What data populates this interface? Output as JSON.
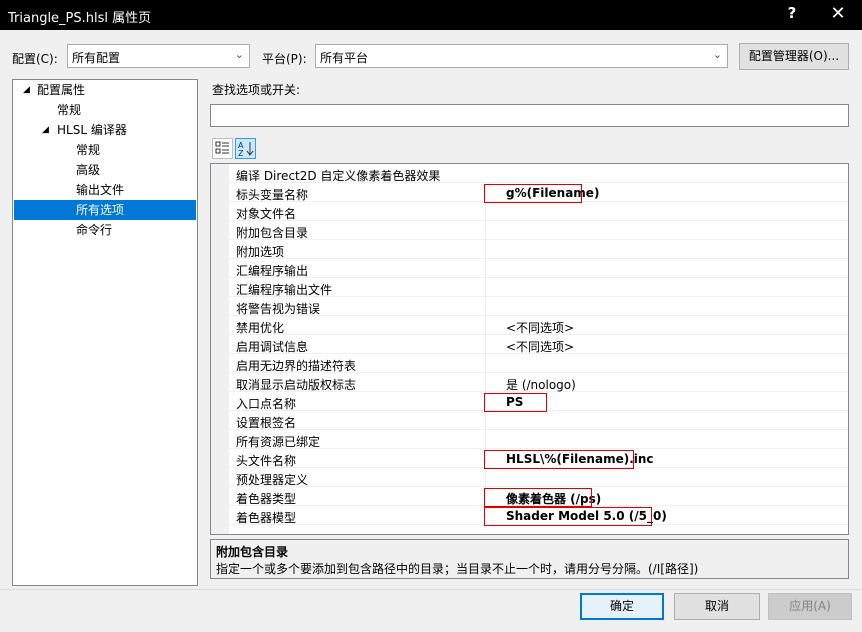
{
  "window": {
    "title": "Triangle_PS.hlsl 属性页",
    "help": "?",
    "close": "✕"
  },
  "config": {
    "label": "配置(C):",
    "value": "所有配置"
  },
  "platform": {
    "label": "平台(P):",
    "value": "所有平台"
  },
  "config_manager_label": "配置管理器(O)...",
  "tree": {
    "root": "配置属性",
    "general": "常规",
    "hlsl": "HLSL 编译器",
    "hlsl_general": "常规",
    "advanced": "高级",
    "output_files": "输出文件",
    "all_options": "所有选项",
    "command_line": "命令行"
  },
  "search_label": "查找选项或开关:",
  "search_value": "",
  "toolbar": {
    "categorized": "categorized-icon",
    "alphabetical": "sort-az-icon"
  },
  "grid": {
    "header": "编译 Direct2D 自定义像素着色器效果",
    "rows": [
      {
        "name": "标头变量名称",
        "value": "g%(Filename)"
      },
      {
        "name": "对象文件名",
        "value": ""
      },
      {
        "name": "附加包含目录",
        "value": ""
      },
      {
        "name": "附加选项",
        "value": ""
      },
      {
        "name": "汇编程序输出",
        "value": ""
      },
      {
        "name": "汇编程序输出文件",
        "value": ""
      },
      {
        "name": "将警告视为错误",
        "value": ""
      },
      {
        "name": "禁用优化",
        "value": "<不同选项>"
      },
      {
        "name": "启用调试信息",
        "value": "<不同选项>"
      },
      {
        "name": "启用无边界的描述符表",
        "value": ""
      },
      {
        "name": "取消显示启动版权标志",
        "value": "是 (/nologo)"
      },
      {
        "name": "入口点名称",
        "value": "PS"
      },
      {
        "name": "设置根签名",
        "value": ""
      },
      {
        "name": "所有资源已绑定",
        "value": ""
      },
      {
        "name": "头文件名称",
        "value": "HLSL\\%(Filename).inc"
      },
      {
        "name": "预处理器定义",
        "value": ""
      },
      {
        "name": "着色器类型",
        "value": "像素着色器 (/ps)"
      },
      {
        "name": "着色器模型",
        "value": "Shader Model 5.0 (/5_0)"
      }
    ]
  },
  "description": {
    "title": "附加包含目录",
    "text": "指定一个或多个要添加到包含路径中的目录；当目录不止一个时，请用分号分隔。(/I[路径])"
  },
  "buttons": {
    "ok": "确定",
    "cancel": "取消",
    "apply": "应用(A)"
  },
  "colors": {
    "selection": "#0078d7",
    "highlight_box": "#e00000"
  }
}
